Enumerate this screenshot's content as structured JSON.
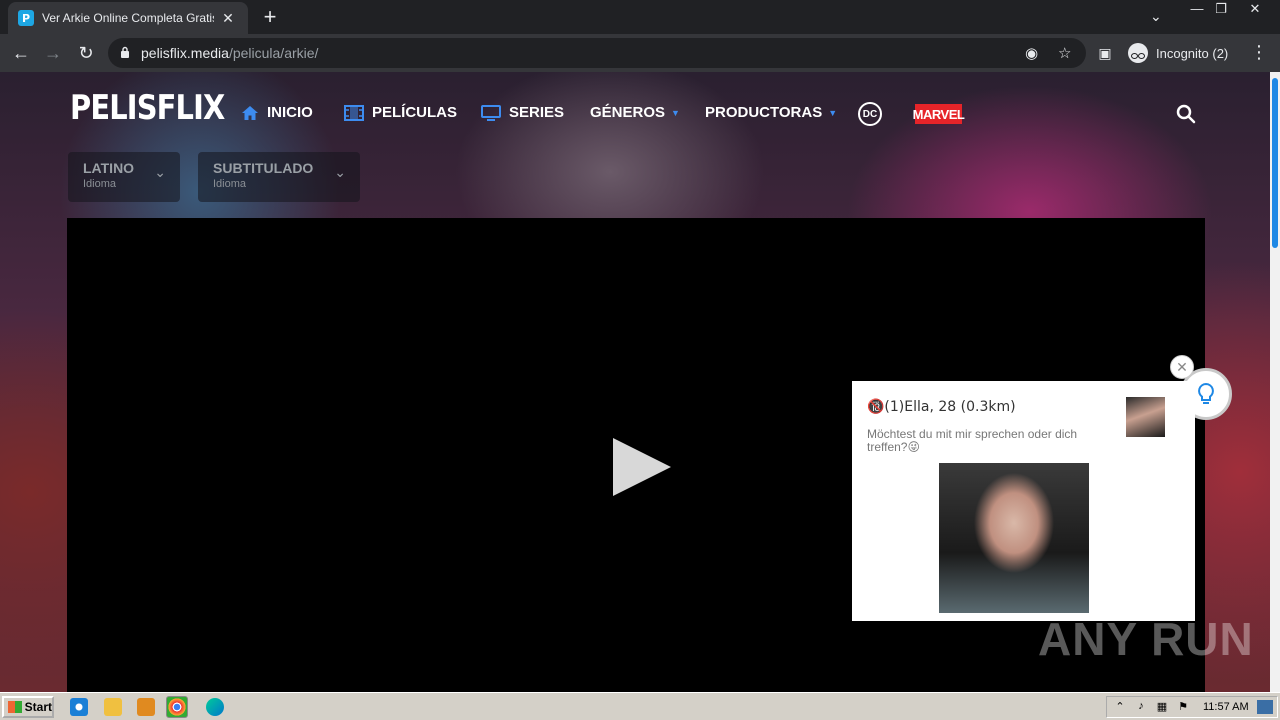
{
  "browser": {
    "tab_title": "Ver Arkie Online Completa Gratis en HD",
    "tab_favicon_letter": "P",
    "url_host": "pelisflix.media",
    "url_path": "/pelicula/arkie/",
    "profile_label": "Incognito (2)"
  },
  "site": {
    "logo": "PELISFLIX",
    "nav": [
      {
        "label": "INICIO",
        "icon": "home-icon"
      },
      {
        "label": "PELÍCULAS",
        "icon": "film-icon"
      },
      {
        "label": "SERIES",
        "icon": "tv-icon"
      },
      {
        "label": "GÉNEROS",
        "icon": "caret-down-icon"
      },
      {
        "label": "PRODUCTORAS",
        "icon": "caret-down-icon"
      }
    ],
    "dc_label": "DC",
    "marvel_label": "MARVEL",
    "languages": [
      {
        "name": "LATINO",
        "sub": "Idioma"
      },
      {
        "name": "SUBTITULADO",
        "sub": "Idioma"
      }
    ]
  },
  "ad": {
    "title": "🔞(1)Ella, 28 (0.3km)",
    "message": "Möchtest du mit mir sprechen oder dich treffen?😜"
  },
  "watermark": "ANY RUN",
  "taskbar": {
    "start_label": "Start",
    "clock": "11:57 AM"
  },
  "colors": {
    "accent": "#3d8cf0",
    "marvel_red": "#e62429"
  }
}
